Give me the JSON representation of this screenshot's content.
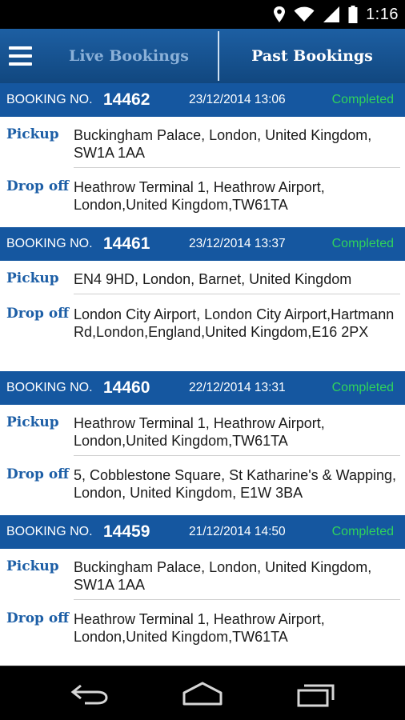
{
  "status_bar": {
    "time": "1:16",
    "icons": [
      "location-icon",
      "wifi-icon",
      "signal-icon",
      "battery-icon"
    ]
  },
  "app_bar": {
    "menu_icon": "hamburger-menu-icon",
    "tabs": [
      {
        "label": "Live Bookings",
        "active": false
      },
      {
        "label": "Past Bookings",
        "active": true
      }
    ]
  },
  "booking_label": "BOOKING NO.",
  "pickup_label": "Pickup",
  "dropoff_label": "Drop off",
  "bookings": [
    {
      "number": "14462",
      "datetime": "23/12/2014 13:06",
      "status": "Completed",
      "pickup": "Buckingham Palace, London, United Kingdom, SW1A 1AA",
      "dropoff": "Heathrow Terminal 1, Heathrow Airport, London,United Kingdom,TW61TA"
    },
    {
      "number": "14461",
      "datetime": "23/12/2014 13:37",
      "status": "Completed",
      "pickup": "EN4 9HD, London, Barnet, United Kingdom",
      "dropoff": "London City Airport, London City Airport,Hartmann Rd,London,England,United Kingdom,E16 2PX"
    },
    {
      "number": "14460",
      "datetime": "22/12/2014 13:31",
      "status": "Completed",
      "pickup": "Heathrow Terminal 1, Heathrow Airport, London,United Kingdom,TW61TA",
      "dropoff": "5, Cobblestone Square, St Katharine's & Wapping, London, United Kingdom, E1W 3BA"
    },
    {
      "number": "14459",
      "datetime": "21/12/2014 14:50",
      "status": "Completed",
      "pickup": "Buckingham Palace, London, United Kingdom, SW1A 1AA",
      "dropoff": "Heathrow Terminal 1, Heathrow Airport, London,United Kingdom,TW61TA"
    }
  ],
  "colors": {
    "header_blue": "#1557a0",
    "status_green": "#2fd25c",
    "label_blue": "#1c5ea6"
  },
  "nav_bar": {
    "icons": [
      "back-icon",
      "home-icon",
      "recents-icon"
    ]
  }
}
